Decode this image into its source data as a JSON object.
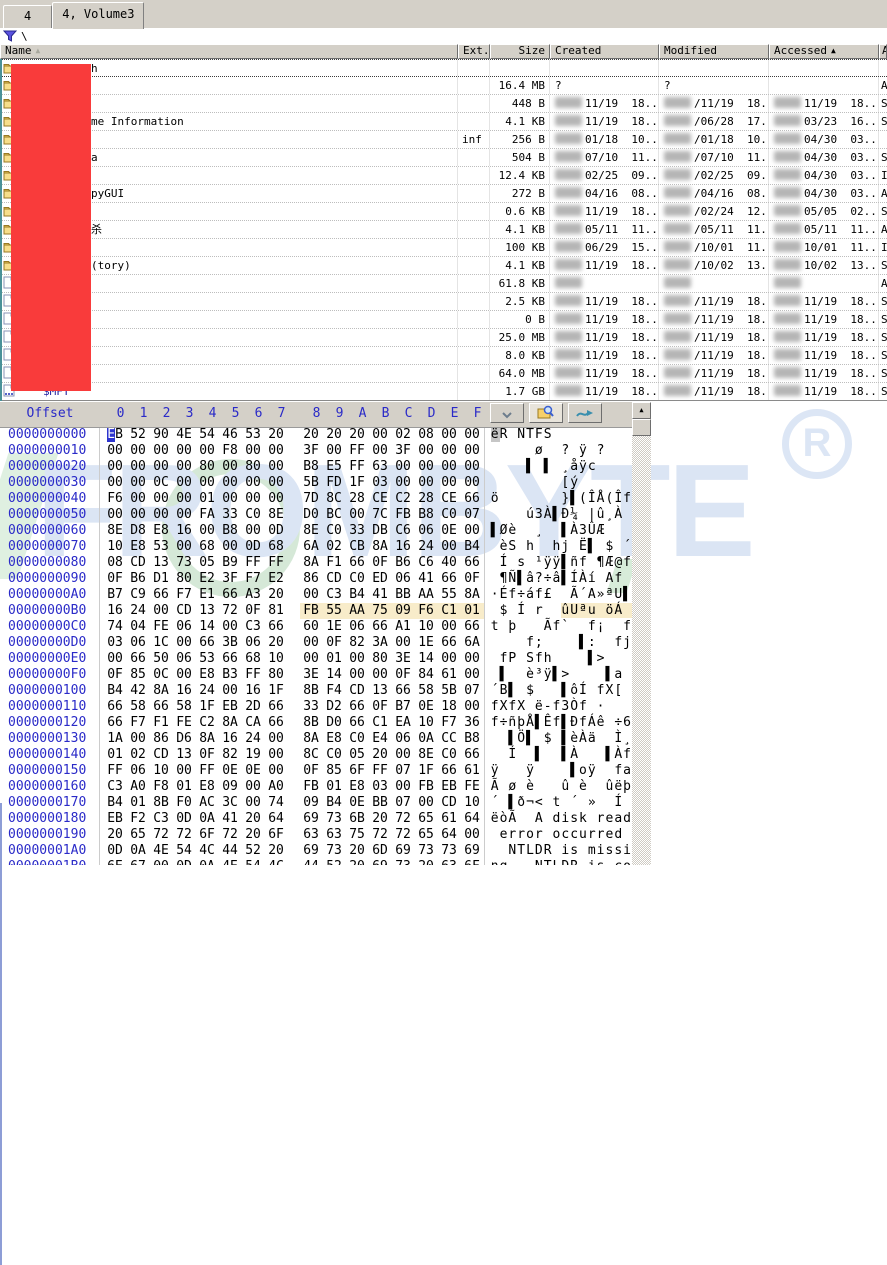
{
  "tabs": [
    {
      "label": "4",
      "active": false
    },
    {
      "label": "4, Volume3",
      "active": true
    }
  ],
  "filter": {
    "icon": "funnel-icon",
    "path": "\\"
  },
  "file_table": {
    "columns": [
      {
        "label": "Name",
        "sort": "secondary"
      },
      {
        "label": "Ext.",
        "sort": ""
      },
      {
        "label": "Size",
        "sort": ""
      },
      {
        "label": "Created",
        "sort": ""
      },
      {
        "label": "Modified",
        "sort": ""
      },
      {
        "label": "Accessed",
        "sort": "primary"
      },
      {
        "label": "A",
        "sort": ""
      }
    ],
    "rows": [
      {
        "icon": "folder-icon",
        "name": "h",
        "ext": "",
        "size": "",
        "created": null,
        "modified": null,
        "accessed": null,
        "attr": "",
        "focus": true
      },
      {
        "icon": "folder-icon",
        "name": "",
        "ext": "",
        "size": "16.4 MB",
        "created": {
          "text": "?"
        },
        "modified": {
          "text": "?"
        },
        "accessed": null,
        "attr": "A"
      },
      {
        "icon": "folder-icon",
        "name": "",
        "ext": "",
        "size": "448 B",
        "created": {
          "blur": true,
          "text": "11/19  18..."
        },
        "modified": {
          "blur": true,
          "text": "/11/19  18..."
        },
        "accessed": {
          "blur": true,
          "text": "11/19  18..."
        },
        "attr": "S"
      },
      {
        "icon": "folder-icon",
        "name": "me Information",
        "ext": "",
        "size": "4.1 KB",
        "created": {
          "blur": true,
          "text": "11/19  18..."
        },
        "modified": {
          "blur": true,
          "text": "/06/28  17..."
        },
        "accessed": {
          "blur": true,
          "text": "03/23  16..."
        },
        "attr": "S"
      },
      {
        "icon": "folder-icon",
        "name": "",
        "ext": "inf",
        "size": "256 B",
        "created": {
          "blur": true,
          "text": "01/18  10..."
        },
        "modified": {
          "blur": true,
          "text": "/01/18  10..."
        },
        "accessed": {
          "blur": true,
          "text": "04/30  03..."
        },
        "attr": ""
      },
      {
        "icon": "folder-icon",
        "name": "a",
        "ext": "",
        "size": "504 B",
        "created": {
          "blur": true,
          "text": "07/10  11..."
        },
        "modified": {
          "blur": true,
          "text": "/07/10  11..."
        },
        "accessed": {
          "blur": true,
          "text": "04/30  03..."
        },
        "attr": "S"
      },
      {
        "icon": "folder-icon",
        "name": "",
        "ext": "",
        "size": "12.4 KB",
        "created": {
          "blur": true,
          "text": "02/25  09..."
        },
        "modified": {
          "blur": true,
          "text": "/02/25  09..."
        },
        "accessed": {
          "blur": true,
          "text": "04/30  03..."
        },
        "attr": "I"
      },
      {
        "icon": "folder-icon",
        "name": "pyGUI",
        "ext": "",
        "size": "272 B",
        "created": {
          "blur": true,
          "text": "04/16  08..."
        },
        "modified": {
          "blur": true,
          "text": "/04/16  08..."
        },
        "accessed": {
          "blur": true,
          "text": "04/30  03..."
        },
        "attr": "A"
      },
      {
        "icon": "folder-icon",
        "name": "",
        "ext": "",
        "size": "0.6 KB",
        "created": {
          "blur": true,
          "text": "11/19  18..."
        },
        "modified": {
          "blur": true,
          "text": "/02/24  12..."
        },
        "accessed": {
          "blur": true,
          "text": "05/05  02..."
        },
        "attr": "S"
      },
      {
        "icon": "folder-icon",
        "name": "杀",
        "ext": "",
        "size": "4.1 KB",
        "created": {
          "blur": true,
          "text": "05/11  11..."
        },
        "modified": {
          "blur": true,
          "text": "/05/11  11..."
        },
        "accessed": {
          "blur": true,
          "text": "05/11  11..."
        },
        "attr": "A"
      },
      {
        "icon": "folder-icon",
        "name": "",
        "ext": "",
        "size": "100 KB",
        "created": {
          "blur": true,
          "text": "06/29  15..."
        },
        "modified": {
          "blur": true,
          "text": "/10/01  11..."
        },
        "accessed": {
          "blur": true,
          "text": "10/01  11..."
        },
        "attr": "I"
      },
      {
        "icon": "folder-icon",
        "name": "(tory)",
        "ext": "",
        "size": "4.1 KB",
        "created": {
          "blur": true,
          "text": "11/19  18..."
        },
        "modified": {
          "blur": true,
          "text": "/10/02  13..."
        },
        "accessed": {
          "blur": true,
          "text": "10/02  13..."
        },
        "attr": "S"
      },
      {
        "icon": "file-icon",
        "name": "",
        "ext": "",
        "size": "61.8 KB",
        "created": {
          "blur": true,
          "text": ""
        },
        "modified": {
          "blur": true,
          "text": ""
        },
        "accessed": {
          "blur": true,
          "text": ""
        },
        "attr": "A"
      },
      {
        "icon": "file-icon",
        "name": "",
        "ext": "",
        "size": "2.5 KB",
        "created": {
          "blur": true,
          "text": "11/19  18..."
        },
        "modified": {
          "blur": true,
          "text": "/11/19  18..."
        },
        "accessed": {
          "blur": true,
          "text": "11/19  18..."
        },
        "attr": "S"
      },
      {
        "icon": "file-icon",
        "name": "",
        "ext": "",
        "size": "0 B",
        "created": {
          "blur": true,
          "text": "11/19  18..."
        },
        "modified": {
          "blur": true,
          "text": "/11/19  18..."
        },
        "accessed": {
          "blur": true,
          "text": "11/19  18..."
        },
        "attr": "S"
      },
      {
        "icon": "file-icon",
        "name": "",
        "ext": "",
        "size": "25.0 MB",
        "created": {
          "blur": true,
          "text": "11/19  18..."
        },
        "modified": {
          "blur": true,
          "text": "/11/19  18..."
        },
        "accessed": {
          "blur": true,
          "text": "11/19  18..."
        },
        "attr": "S"
      },
      {
        "icon": "file-icon",
        "name": "",
        "ext": "",
        "size": "8.0 KB",
        "created": {
          "blur": true,
          "text": "11/19  18..."
        },
        "modified": {
          "blur": true,
          "text": "/11/19  18..."
        },
        "accessed": {
          "blur": true,
          "text": "11/19  18..."
        },
        "attr": "S"
      },
      {
        "icon": "file-icon",
        "name": "",
        "ext": "",
        "size": "64.0 MB",
        "created": {
          "blur": true,
          "text": "11/19  18..."
        },
        "modified": {
          "blur": true,
          "text": "/11/19  18..."
        },
        "accessed": {
          "blur": true,
          "text": "11/19  18..."
        },
        "attr": "S"
      },
      {
        "icon": "sysfile-icon",
        "name": "$MFT",
        "ext": "",
        "size": "1.7 GB",
        "created": {
          "blur": true,
          "text": "11/19  18..."
        },
        "modified": {
          "blur": true,
          "text": "/11/19  18..."
        },
        "accessed": {
          "blur": true,
          "text": "11/19  18..."
        },
        "attr": "S"
      }
    ]
  },
  "hex_view": {
    "offset_label": "Offset",
    "col_labels": [
      "0",
      "1",
      "2",
      "3",
      "4",
      "5",
      "6",
      "7",
      "8",
      "9",
      "A",
      "B",
      "C",
      "D",
      "E",
      "F"
    ],
    "toolbar": [
      {
        "icon": "dropdown-icon",
        "selected": false
      },
      {
        "icon": "search-icon",
        "selected": true
      },
      {
        "icon": "sync-arrow-icon",
        "selected": false
      }
    ],
    "rows": [
      {
        "o": "0000000000",
        "b": "EB 52 90 4E 54 46 53 20 20 20 20 00 02 08 00 00",
        "a": "ëR NTFS         ",
        "cursor": true
      },
      {
        "o": "0000000010",
        "b": "00 00 00 00 00 F8 00 00 3F 00 FF 00 3F 00 00 00",
        "a": "     ø  ? ÿ ?   "
      },
      {
        "o": "0000000020",
        "b": "00 00 00 00 80 00 80 00 B8 E5 FF 63 00 00 00 00",
        "a": "    ▌ ▌ ¸åÿc    "
      },
      {
        "o": "0000000030",
        "b": "00 00 0C 00 00 00 00 00 5B FD 1F 03 00 00 00 00",
        "a": "        [ý      "
      },
      {
        "o": "0000000040",
        "b": "F6 00 00 00 01 00 00 00 7D 8C 28 CE C2 28 CE 66",
        "a": "ö       }▌(ÎÅ(Îf"
      },
      {
        "o": "0000000050",
        "b": "00 00 00 00 FA 33 C0 8E D0 BC 00 7C FB B8 C0 07",
        "a": "    ú3À▌Đ¼ |û¸À "
      },
      {
        "o": "0000000060",
        "b": "8E D8 E8 16 00 B8 00 0D 8E C0 33 DB C6 06 0E 00",
        "a": "▌Øè  ¸  ▌À3ÛÆ   "
      },
      {
        "o": "0000000070",
        "b": "10 E8 53 00 68 00 0D 68 6A 02 CB 8A 16 24 00 B4",
        "a": " èS h  hj Ë▌ $ ´"
      },
      {
        "o": "0000000080",
        "b": "08 CD 13 73 05 B9 FF FF 8A F1 66 0F B6 C6 40 66",
        "a": " Í s ¹ÿÿ▌ñf ¶Æ@f"
      },
      {
        "o": "0000000090",
        "b": "0F B6 D1 80 E2 3F F7 E2 86 CD C0 ED 06 41 66 0F",
        "a": " ¶Ñ▌â?÷â▌ÍÀí Af "
      },
      {
        "o": "00000000A0",
        "b": "B7 C9 66 F7 E1 66 A3 20 00 C3 B4 41 BB AA 55 8A",
        "a": "·Éf÷áf£  Ã´A»ªU▌"
      },
      {
        "o": "00000000B0",
        "b": "16 24 00 CD 13 72 0F 81 FB 55 AA 75 09 F6 C1 01",
        "a": " $ Í r  ûUªu öÁ ",
        "hl": [
          8,
          16
        ]
      },
      {
        "o": "00000000C0",
        "b": "74 04 FE 06 14 00 C3 66 60 1E 06 66 A1 10 00 66",
        "a": "t þ   Ãf`  f¡  f"
      },
      {
        "o": "00000000D0",
        "b": "03 06 1C 00 66 3B 06 20 00 0F 82 3A 00 1E 66 6A",
        "a": "    f;    ▌:  fj"
      },
      {
        "o": "00000000E0",
        "b": "00 66 50 06 53 66 68 10 00 01 00 80 3E 14 00 00",
        "a": " fP Sfh    ▌>   "
      },
      {
        "o": "00000000F0",
        "b": "0F 85 0C 00 E8 B3 FF 80 3E 14 00 00 0F 84 61 00",
        "a": " ▌  è³ÿ▌>    ▌a "
      },
      {
        "o": "0000000100",
        "b": "B4 42 8A 16 24 00 16 1F 8B F4 CD 13 66 58 5B 07",
        "a": "´B▌ $   ▌ôÍ fX[ "
      },
      {
        "o": "0000000110",
        "b": "66 58 66 58 1F EB 2D 66 33 D2 66 0F B7 0E 18 00",
        "a": "fXfX ë-f3Òf ·   "
      },
      {
        "o": "0000000120",
        "b": "66 F7 F1 FE C2 8A CA 66 8B D0 66 C1 EA 10 F7 36",
        "a": "f÷ñþÅ▌Êf▌ĐfÁê ÷6"
      },
      {
        "o": "0000000130",
        "b": "1A 00 86 D6 8A 16 24 00 8A E8 C0 E4 06 0A CC B8",
        "a": "  ▌Ö▌ $ ▌èÀä  Ì¸"
      },
      {
        "o": "0000000140",
        "b": "01 02 CD 13 0F 82 19 00 8C C0 05 20 00 8E C0 66",
        "a": "  Í  ▌  ▌À   ▌Àf"
      },
      {
        "o": "0000000150",
        "b": "FF 06 10 00 FF 0E 0E 00 0F 85 6F FF 07 1F 66 61",
        "a": "ÿ   ÿ    ▌oÿ  fa"
      },
      {
        "o": "0000000160",
        "b": "C3 A0 F8 01 E8 09 00 A0 FB 01 E8 03 00 FB EB FE",
        "a": "Ã ø è   û è  ûëþ"
      },
      {
        "o": "0000000170",
        "b": "B4 01 8B F0 AC 3C 00 74 09 B4 0E BB 07 00 CD 10",
        "a": "´ ▌ð¬< t ´ »  Í "
      },
      {
        "o": "0000000180",
        "b": "EB F2 C3 0D 0A 41 20 64 69 73 6B 20 72 65 61 64",
        "a": "ëòÃ  A disk read"
      },
      {
        "o": "0000000190",
        "b": "20 65 72 72 6F 72 20 6F 63 63 75 72 72 65 64 00",
        "a": " error occurred "
      },
      {
        "o": "00000001A0",
        "b": "0D 0A 4E 54 4C 44 52 20 69 73 20 6D 69 73 73 69",
        "a": "  NTLDR is missi"
      },
      {
        "o": "00000001B0",
        "b": "6E 67 00 0D 0A 4E 54 4C 44 52 20 69 73 20 63 6F",
        "a": "ng   NTLDR is co"
      }
    ]
  },
  "watermark": {
    "text": "FROMBYTE",
    "symbol": "R"
  }
}
